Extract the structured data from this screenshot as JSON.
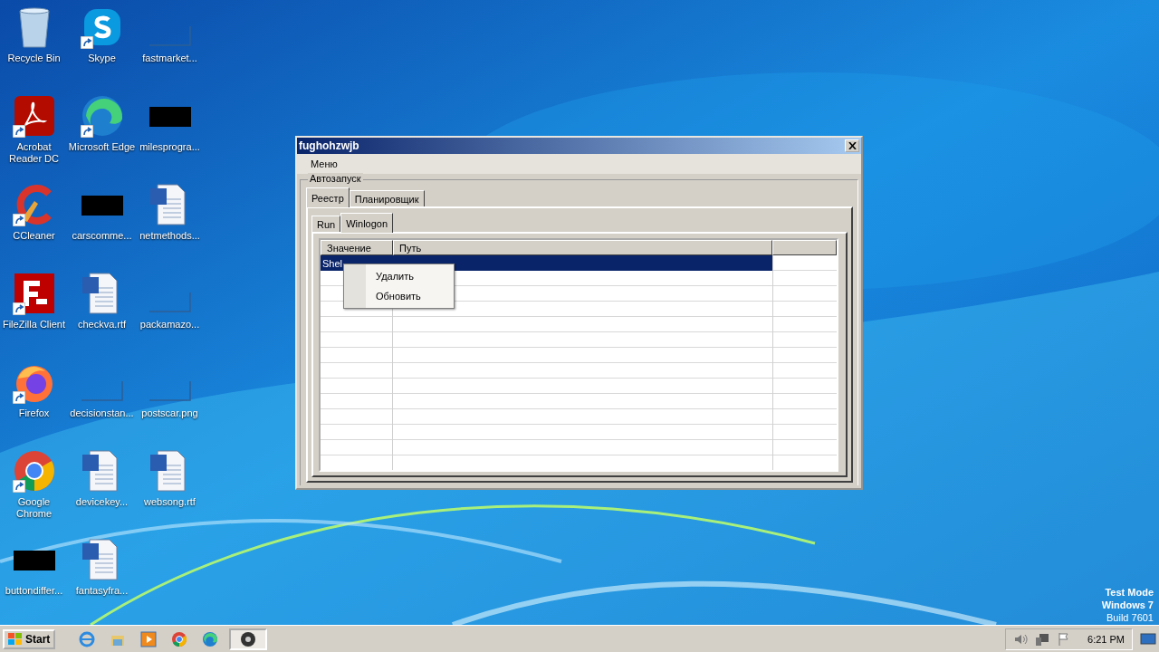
{
  "desktop": {
    "icons": [
      {
        "label": "Recycle Bin",
        "kind": "recycle",
        "shortcut": false
      },
      {
        "label": "Acrobat Reader DC",
        "kind": "acrobat",
        "shortcut": true
      },
      {
        "label": "CCleaner",
        "kind": "ccleaner",
        "shortcut": true
      },
      {
        "label": "FileZilla Client",
        "kind": "filezilla",
        "shortcut": true
      },
      {
        "label": "Firefox",
        "kind": "firefox",
        "shortcut": true
      },
      {
        "label": "Google Chrome",
        "kind": "chrome",
        "shortcut": true
      },
      {
        "label": "buttondiffer...",
        "kind": "dark",
        "shortcut": false
      },
      {
        "label": "Skype",
        "kind": "skype",
        "shortcut": true
      },
      {
        "label": "Microsoft Edge",
        "kind": "edge",
        "shortcut": true
      },
      {
        "label": "carscomme...",
        "kind": "dark",
        "shortcut": false
      },
      {
        "label": "checkva.rtf",
        "kind": "word",
        "shortcut": false
      },
      {
        "label": "decisionstan...",
        "kind": "blank",
        "shortcut": false
      },
      {
        "label": "devicekey...",
        "kind": "word",
        "shortcut": false
      },
      {
        "label": "fantasyfra...",
        "kind": "word",
        "shortcut": false
      },
      {
        "label": "fastmarket...",
        "kind": "blank",
        "shortcut": false
      },
      {
        "label": "milesprogra...",
        "kind": "dark",
        "shortcut": false
      },
      {
        "label": "netmethods...",
        "kind": "word",
        "shortcut": false
      },
      {
        "label": "packamazo...",
        "kind": "blank",
        "shortcut": false
      },
      {
        "label": "postscar.png",
        "kind": "blank",
        "shortcut": false
      },
      {
        "label": "websong.rtf",
        "kind": "word",
        "shortcut": false
      }
    ]
  },
  "window": {
    "title": "fughohzwjb",
    "menu": [
      "Меню"
    ],
    "group": "Автозапуск",
    "tabs": [
      {
        "label": "Реестр",
        "selected": true
      },
      {
        "label": "Планировщик",
        "selected": false
      }
    ],
    "subtabs": [
      {
        "label": "Run",
        "selected": false
      },
      {
        "label": "Winlogon",
        "selected": true
      }
    ],
    "table": {
      "columns": [
        "Значение",
        "Путь"
      ],
      "rows": [
        {
          "cells": [
            "Shel"
          ],
          "selected": true
        }
      ]
    },
    "context_menu": {
      "items": [
        "Удалить",
        "Обновить"
      ]
    }
  },
  "system_info": [
    "Test Mode",
    "Windows 7",
    "Build 7601"
  ],
  "taskbar": {
    "start": "Start",
    "items": [
      {
        "kind": "ie",
        "active": false
      },
      {
        "kind": "explorer",
        "active": false
      },
      {
        "kind": "media",
        "active": false
      },
      {
        "kind": "chrome",
        "active": false
      },
      {
        "kind": "edge",
        "active": false
      },
      {
        "kind": "app",
        "active": true
      }
    ],
    "clock": "6:21 PM"
  }
}
